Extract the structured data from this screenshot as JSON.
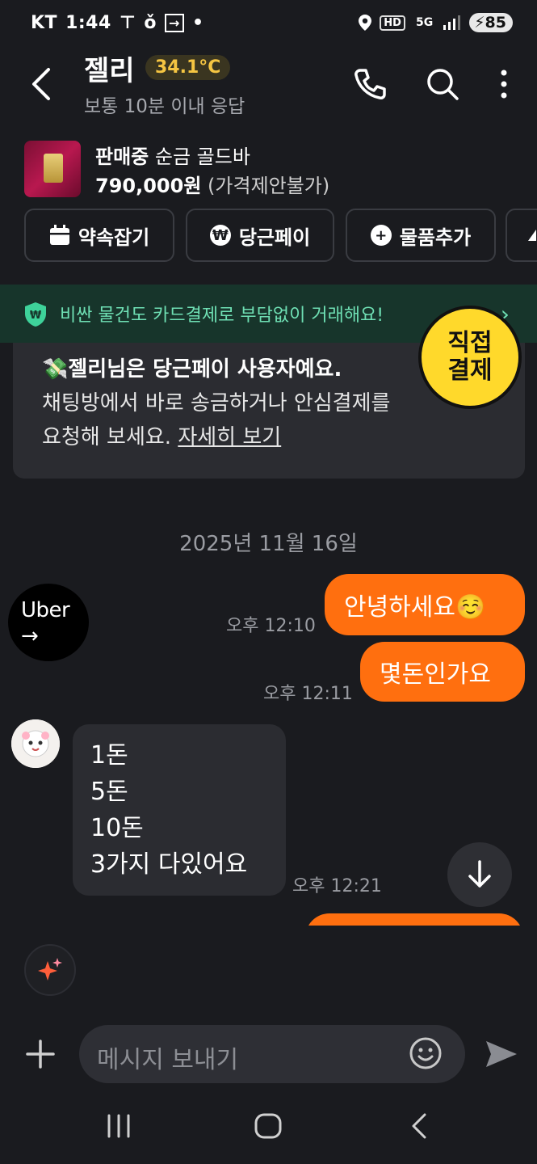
{
  "status": {
    "carrier": "KT",
    "time": "1:44",
    "battery": "85",
    "hd_label": "HD",
    "network": "5G"
  },
  "header": {
    "name": "젤리",
    "temperature": "34.1°C",
    "response_time": "보통 10분 이내 응답",
    "icons": [
      "back-arrow-icon",
      "phone-icon",
      "search-icon",
      "more-vertical-icon"
    ]
  },
  "product": {
    "status": "판매중",
    "title": "순금 골드바",
    "price": "790,000원",
    "price_note": "(가격제안불가)"
  },
  "actions": [
    {
      "label": "약속잡기",
      "icon": "calendar-icon"
    },
    {
      "label": "당근페이",
      "icon": "won-icon"
    },
    {
      "label": "물품추가",
      "icon": "plus-circle-icon"
    }
  ],
  "banner": {
    "text": "비싼 물건도 카드결제로 부담없이 거래해요!"
  },
  "sticker": {
    "line1": "직접",
    "line2": "결제"
  },
  "pay_notice": {
    "emoji": "💸",
    "line1": "젤리님은 당근페이 사용자예요.",
    "line2": "채팅방에서 바로 송금하거나 안심결제를",
    "line3": "요청해 보세요.",
    "link": "자세히 보기"
  },
  "date_divider": "2025년 11월 16일",
  "messages": {
    "m1": {
      "text": "안녕하세요☺️",
      "time": "오후 12:10"
    },
    "m2": {
      "text": "몇돈인가요",
      "time": "오후 12:11"
    },
    "m3": {
      "lines": [
        "1돈",
        "5돈",
        "10돈",
        "3가지 다있어요"
      ],
      "time": "오후 12:21"
    }
  },
  "uber": {
    "text": "Uber",
    "arrow": "→"
  },
  "composer": {
    "placeholder": "메시지 보내기"
  },
  "colors": {
    "accent": "#ff6f0f",
    "background": "#1a1b1f",
    "banner_bg": "#17352b",
    "banner_text": "#6fe0b4",
    "temp": "#f5c542"
  }
}
